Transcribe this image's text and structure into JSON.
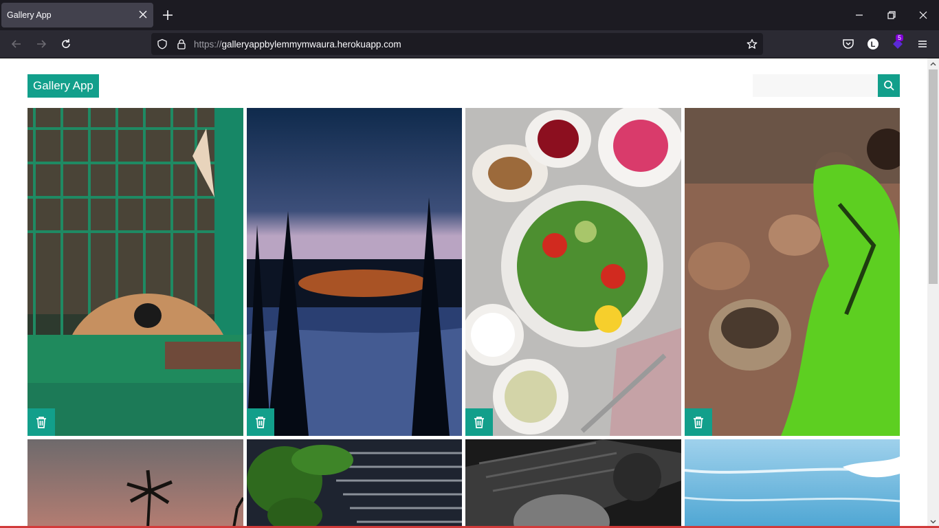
{
  "browser": {
    "tab_title": "Gallery App",
    "url_scheme": "https://",
    "url_host": "galleryappbylemmymwaura.herokuapp.com",
    "extension_badge": "5",
    "account_initial": "L"
  },
  "page": {
    "brand": "Gallery App",
    "search_placeholder": "",
    "accent_color": "#129f8b"
  },
  "gallery": {
    "images": [
      {
        "subject": "dog behind green cage",
        "action_icon": "trash-icon"
      },
      {
        "subject": "snowy forest at dusk",
        "action_icon": "trash-icon"
      },
      {
        "subject": "salad with bowls",
        "action_icon": "trash-icon"
      },
      {
        "subject": "woman making clay pots",
        "action_icon": "trash-icon"
      },
      {
        "subject": "palm trees at sunset"
      },
      {
        "subject": "spinach on striped cloth"
      },
      {
        "subject": "black and white close-up"
      },
      {
        "subject": "ocean waves"
      }
    ]
  }
}
